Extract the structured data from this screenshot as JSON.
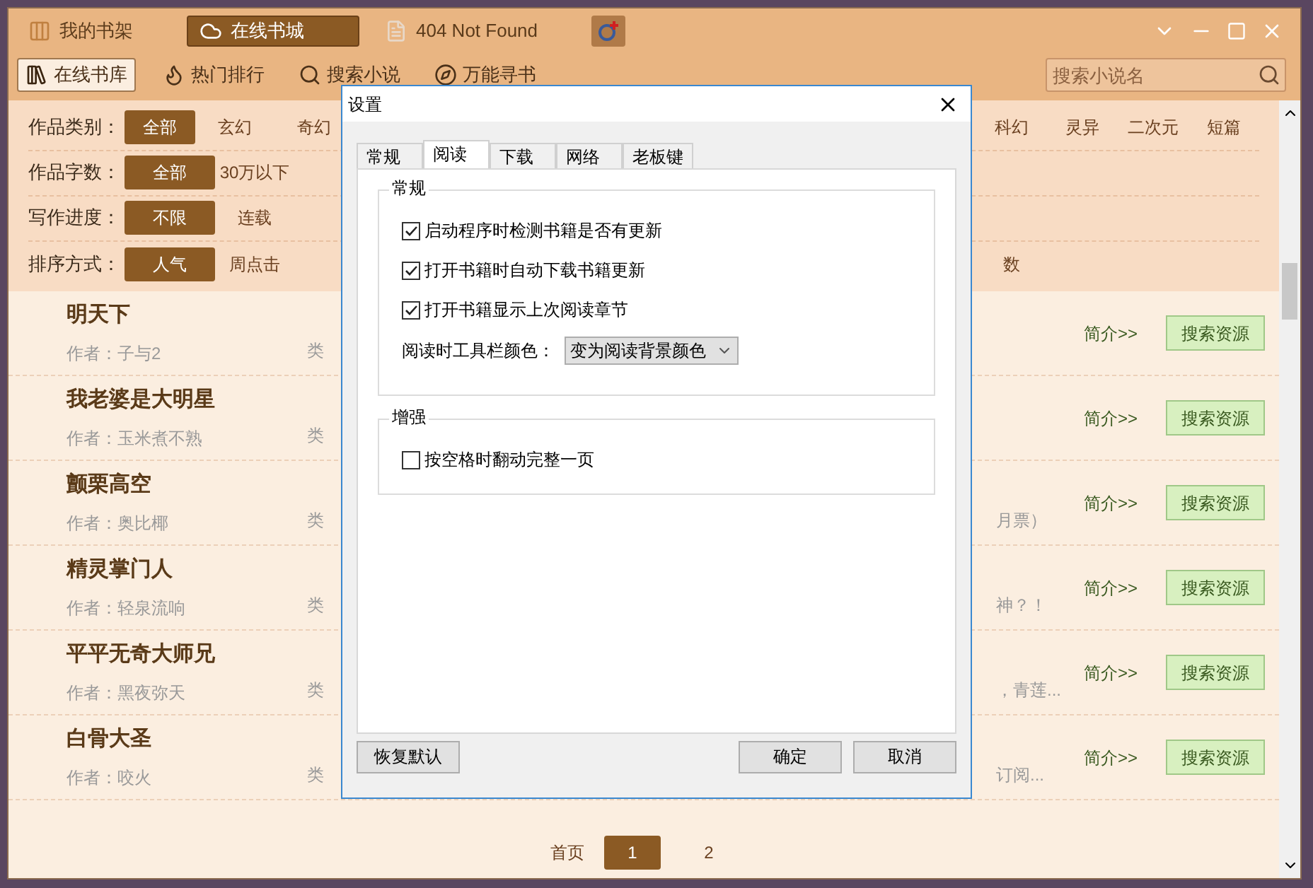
{
  "app": {
    "top_tabs": [
      {
        "label": "我的书架",
        "kind": "shelf",
        "selected": false
      },
      {
        "label": "在线书城",
        "kind": "cloud",
        "selected": true
      },
      {
        "label": "404 Not Found",
        "kind": "page",
        "selected": false
      }
    ],
    "toolbar": [
      {
        "label": "在线书库",
        "kind": "books",
        "selected": true
      },
      {
        "label": "热门排行",
        "kind": "flame",
        "selected": false
      },
      {
        "label": "搜索小说",
        "kind": "search",
        "selected": false
      },
      {
        "label": "万能寻书",
        "kind": "compass",
        "selected": false
      }
    ],
    "search": {
      "placeholder": "搜索小说名"
    },
    "filters": [
      {
        "label": "作品类别：",
        "options": [
          {
            "label": "全部",
            "selected": true
          },
          {
            "label": "玄幻",
            "selected": false
          },
          {
            "label": "奇幻",
            "selected": false
          }
        ],
        "right_options": [
          {
            "label": "科幻",
            "selected": false
          },
          {
            "label": "灵异",
            "selected": false
          },
          {
            "label": "二次元",
            "selected": false
          },
          {
            "label": "短篇",
            "selected": false
          }
        ]
      },
      {
        "label": "作品字数：",
        "options": [
          {
            "label": "全部",
            "selected": true
          },
          {
            "label": "30万以下",
            "selected": false
          }
        ]
      },
      {
        "label": "写作进度：",
        "options": [
          {
            "label": "不限",
            "selected": true
          },
          {
            "label": "连载",
            "selected": false
          }
        ]
      },
      {
        "label": "排序方式：",
        "options": [
          {
            "label": "人气",
            "selected": true
          },
          {
            "label": "周点击",
            "selected": false
          }
        ],
        "right_options": [
          {
            "label": "数",
            "selected": false
          }
        ]
      }
    ],
    "books": [
      {
        "title": "明天下",
        "author": "作者：子与2",
        "type": "类",
        "intro": "简介>>",
        "button": "搜索资源"
      },
      {
        "title": "我老婆是大明星",
        "author": "作者：玉米煮不熟",
        "type": "类",
        "intro": "简介>>",
        "button": "搜索资源"
      },
      {
        "title": "颤栗高空",
        "author": "作者：奥比椰",
        "type": "类",
        "extra": "月票）",
        "intro": "简介>>",
        "button": "搜索资源"
      },
      {
        "title": "精灵掌门人",
        "author": "作者：轻泉流响",
        "type": "类",
        "extra": "神？！",
        "intro": "简介>>",
        "button": "搜索资源"
      },
      {
        "title": "平平无奇大师兄",
        "author": "作者：黑夜弥天",
        "type": "类",
        "extra": "，青莲...",
        "intro": "简介>>",
        "button": "搜索资源"
      },
      {
        "title": "白骨大圣",
        "author": "作者：咬火",
        "type": "类",
        "extra": "订阅...",
        "intro": "简介>>",
        "button": "搜索资源"
      }
    ],
    "pager": {
      "first": "首页",
      "pages": [
        {
          "label": "1",
          "selected": true
        },
        {
          "label": "2",
          "selected": false
        }
      ]
    }
  },
  "dialog": {
    "title": "设置",
    "tabs": [
      {
        "label": "常规",
        "selected": false
      },
      {
        "label": "阅读",
        "selected": true
      },
      {
        "label": "下载",
        "selected": false
      },
      {
        "label": "网络",
        "selected": false
      },
      {
        "label": "老板键",
        "selected": false
      }
    ],
    "groups": [
      {
        "title": "常规",
        "items": [
          {
            "kind": "checkbox",
            "label": "启动程序时检测书籍是否有更新",
            "checked": true
          },
          {
            "kind": "checkbox",
            "label": "打开书籍时自动下载书籍更新",
            "checked": true
          },
          {
            "kind": "checkbox",
            "label": "打开书籍显示上次阅读章节",
            "checked": true
          },
          {
            "kind": "select",
            "label": "阅读时工具栏颜色：",
            "value": "变为阅读背景颜色"
          }
        ]
      },
      {
        "title": "增强",
        "items": [
          {
            "kind": "checkbox",
            "label": "按空格时翻动完整一页",
            "checked": false
          }
        ]
      }
    ],
    "reset": "恢复默认",
    "ok": "确定",
    "cancel": "取消"
  }
}
